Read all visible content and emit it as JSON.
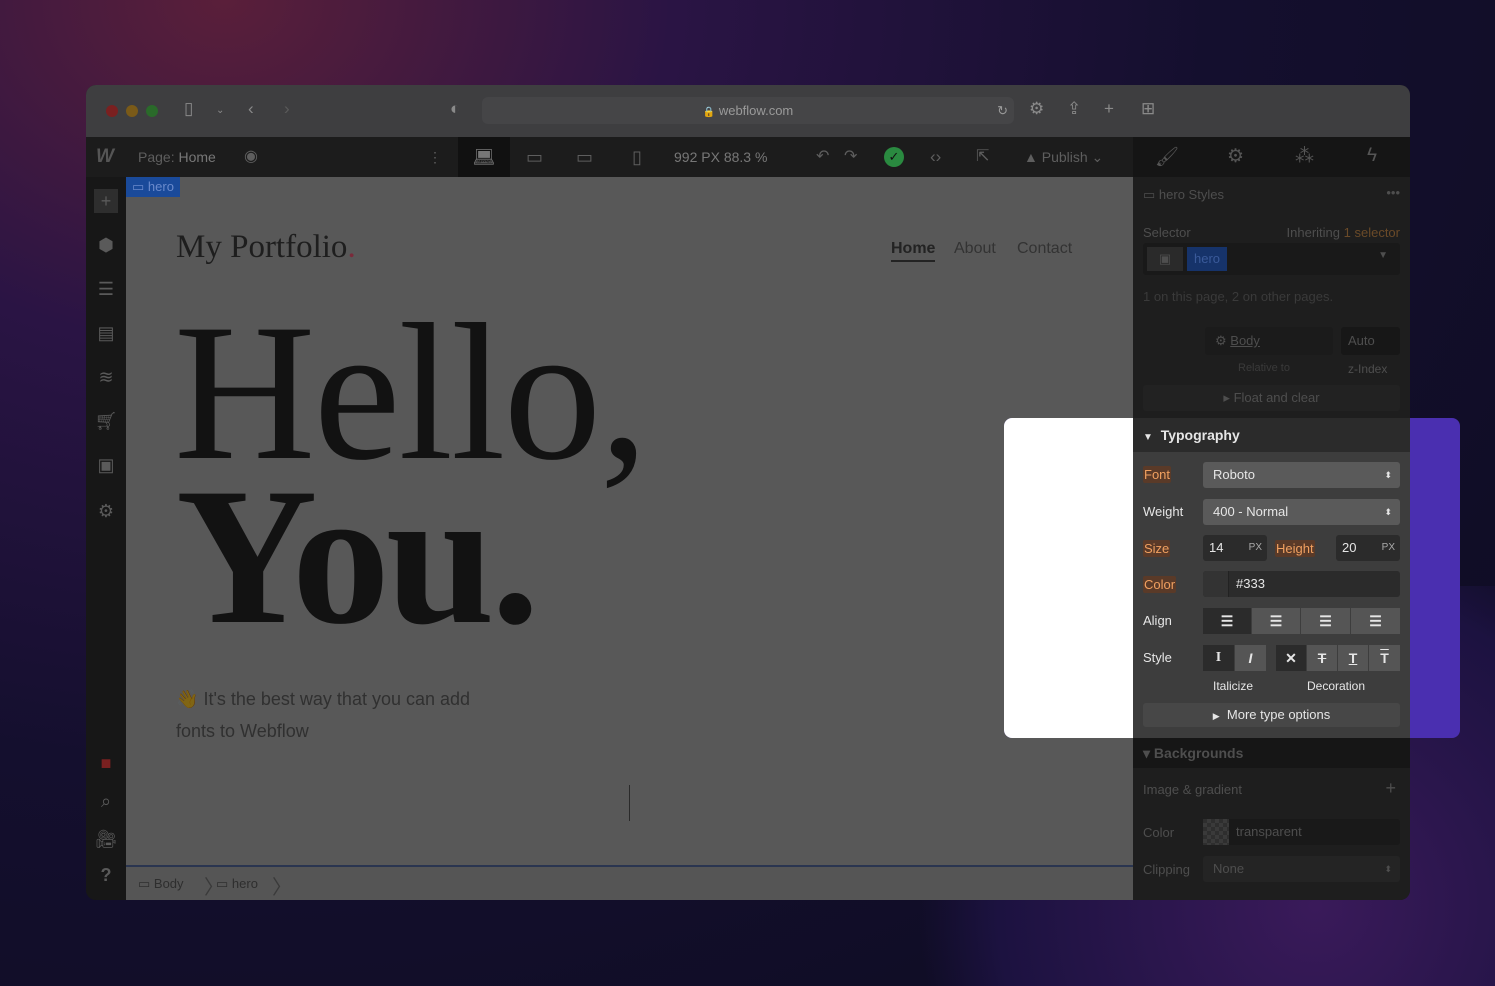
{
  "browser": {
    "url": "webflow.com"
  },
  "toolbar": {
    "page_label": "Page:",
    "page_name": "Home",
    "width": "992",
    "width_unit": "PX",
    "zoom": "88.3",
    "zoom_unit": "%",
    "publish": "Publish"
  },
  "canvas": {
    "selected_tag": "hero",
    "logo": "My Portfolio",
    "logo_dot": ".",
    "nav": [
      "Home",
      "About",
      "Contact"
    ],
    "headline_1": "Hello,",
    "headline_2": "You.",
    "emoji": "👋",
    "paragraph_1": "It's the best way that you can add",
    "paragraph_2": "fonts to Webflow"
  },
  "breadcrumbs": [
    "Body",
    "hero"
  ],
  "style_panel": {
    "title": "hero Styles",
    "selector_label": "Selector",
    "inheriting": "Inheriting",
    "inheriting_count": "1 selector",
    "selector_chip": "hero",
    "usage": "1 on this page, 2 on other pages.",
    "relative_value": "Body",
    "relative_label": "Relative to",
    "zindex_value": "Auto",
    "zindex_label": "z-Index",
    "float_clear": "Float and clear",
    "typography": {
      "header": "Typography",
      "font_label": "Font",
      "font_value": "Roboto",
      "weight_label": "Weight",
      "weight_value": "400 - Normal",
      "size_label": "Size",
      "size_value": "14",
      "size_unit": "PX",
      "height_label": "Height",
      "height_value": "20",
      "height_unit": "PX",
      "color_label": "Color",
      "color_value": "#333",
      "align_label": "Align",
      "style_label": "Style",
      "italicize_label": "Italicize",
      "decoration_label": "Decoration",
      "more": "More type options"
    },
    "backgrounds": {
      "header": "Backgrounds",
      "image_gradient": "Image & gradient",
      "color_label": "Color",
      "color_value": "transparent",
      "clipping_label": "Clipping",
      "clipping_value": "None"
    }
  },
  "colors": {
    "accent_orange": "#f0a060",
    "selector_blue": "#1a55c8",
    "highlight_purple": "#4a2fb0",
    "publish_check": "#2fa84f"
  }
}
